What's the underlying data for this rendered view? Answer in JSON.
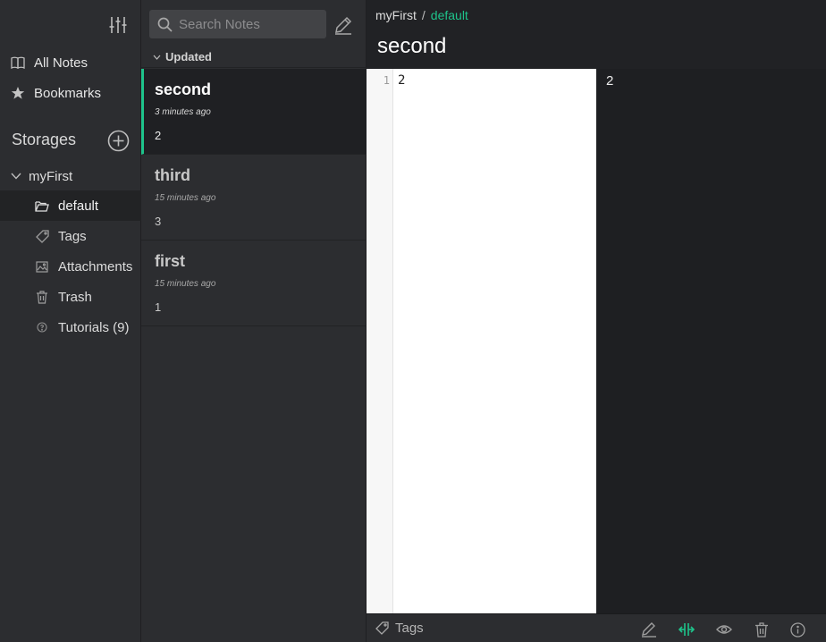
{
  "sidebar": {
    "top_items": [
      {
        "label": "All Notes",
        "icon": "book-icon"
      },
      {
        "label": "Bookmarks",
        "icon": "star-icon"
      }
    ],
    "storages_title": "Storages",
    "storage": {
      "name": "myFirst",
      "items": [
        {
          "label": "default",
          "icon": "folder-open-icon",
          "active": true
        },
        {
          "label": "Tags",
          "icon": "tag-icon"
        },
        {
          "label": "Attachments",
          "icon": "image-icon"
        },
        {
          "label": "Trash",
          "icon": "trash-icon"
        },
        {
          "label": "Tutorials (9)",
          "icon": "help-icon"
        }
      ]
    }
  },
  "notelist": {
    "search_placeholder": "Search Notes",
    "sort_label": "Updated",
    "notes": [
      {
        "title": "second",
        "time": "3 minutes ago",
        "preview": "2",
        "active": true
      },
      {
        "title": "third",
        "time": "15 minutes ago",
        "preview": "3"
      },
      {
        "title": "first",
        "time": "15 minutes ago",
        "preview": "1"
      }
    ]
  },
  "editor": {
    "breadcrumb_storage": "myFirst",
    "breadcrumb_sep": "/",
    "breadcrumb_folder": "default",
    "title": "second",
    "line_number": "1",
    "content": "2",
    "preview": "2",
    "footer": {
      "tags_label": "Tags",
      "buttons": [
        "edit-icon",
        "split-view-icon",
        "preview-icon",
        "trash-icon",
        "info-icon"
      ]
    }
  },
  "colors": {
    "accent": "#1ec38b",
    "sidebar_bg": "#2c2d30",
    "editor_bg": "#1e1f22",
    "code_bg": "#ffffff"
  }
}
